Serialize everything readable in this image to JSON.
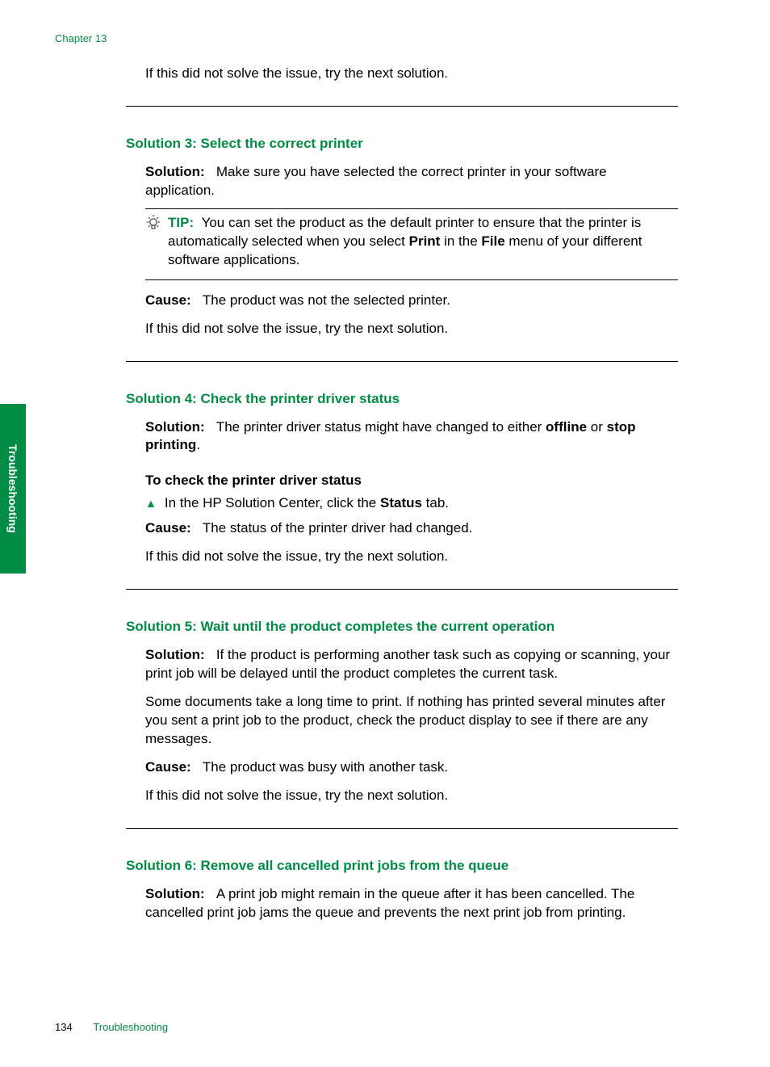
{
  "chapter": "Chapter 13",
  "intro_retry": "If this did not solve the issue, try the next solution.",
  "s3": {
    "heading": "Solution 3: Select the correct printer",
    "solution_label": "Solution:",
    "solution_text": "Make sure you have selected the correct printer in your software application.",
    "tip_label": "TIP:",
    "tip_text_1": "You can set the product as the default printer to ensure that the printer is automatically selected when you select ",
    "tip_print": "Print",
    "tip_in_the": " in the ",
    "tip_file": "File",
    "tip_text_2": " menu of your different software applications.",
    "cause_label": "Cause:",
    "cause_text": "The product was not the selected printer.",
    "retry": "If this did not solve the issue, try the next solution."
  },
  "s4": {
    "heading": "Solution 4: Check the printer driver status",
    "solution_label": "Solution:",
    "solution_text_1": "The printer driver status might have changed to either ",
    "offline": "offline",
    "or": " or ",
    "stop_printing": "stop printing",
    "period": ".",
    "proc_heading": "To check the printer driver status",
    "step_text_1": "In the HP Solution Center, click the ",
    "status": "Status",
    "step_text_2": " tab.",
    "cause_label": "Cause:",
    "cause_text": "The status of the printer driver had changed.",
    "retry": "If this did not solve the issue, try the next solution."
  },
  "s5": {
    "heading": "Solution 5: Wait until the product completes the current operation",
    "solution_label": "Solution:",
    "solution_text": "If the product is performing another task such as copying or scanning, your print job will be delayed until the product completes the current task.",
    "para2": "Some documents take a long time to print. If nothing has printed several minutes after you sent a print job to the product, check the product display to see if there are any messages.",
    "cause_label": "Cause:",
    "cause_text": "The product was busy with another task.",
    "retry": "If this did not solve the issue, try the next solution."
  },
  "s6": {
    "heading": "Solution 6: Remove all cancelled print jobs from the queue",
    "solution_label": "Solution:",
    "solution_text": "A print job might remain in the queue after it has been cancelled. The cancelled print job jams the queue and prevents the next print job from printing."
  },
  "side_tab": "Troubleshooting",
  "page_number": "134",
  "footer_label": "Troubleshooting"
}
